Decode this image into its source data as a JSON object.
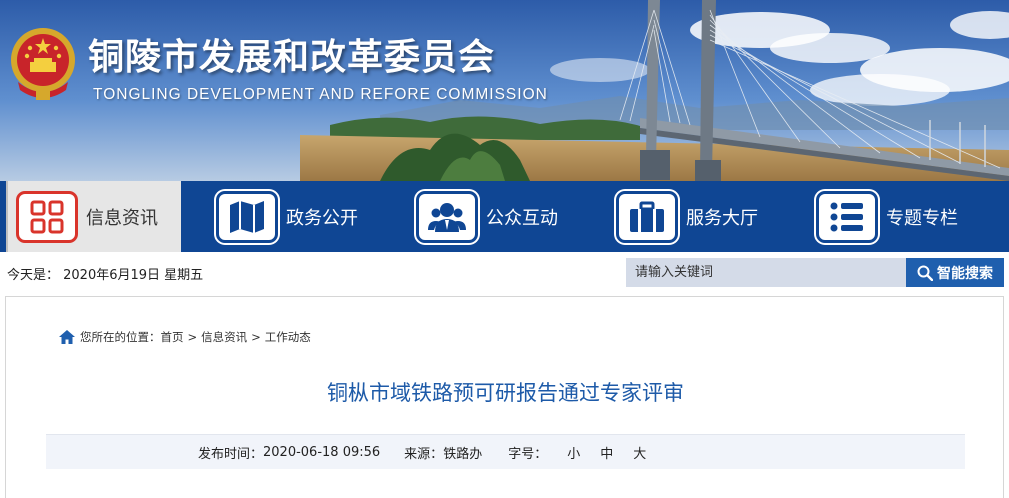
{
  "header": {
    "title": "铜陵市发展和改革委员会",
    "subtitle": "TONGLING DEVELOPMENT AND REFORE COMMISSION"
  },
  "nav": {
    "items": [
      {
        "label": "信息资讯",
        "icon": "grid-icon",
        "active": true
      },
      {
        "label": "政务公开",
        "icon": "map-icon",
        "active": false
      },
      {
        "label": "公众互动",
        "icon": "people-icon",
        "active": false
      },
      {
        "label": "服务大厅",
        "icon": "briefcase-icon",
        "active": false
      },
      {
        "label": "专题专栏",
        "icon": "list-icon",
        "active": false
      }
    ]
  },
  "infobar": {
    "date_text": "今天是： 2020年6月19日 星期五",
    "search_placeholder": "请输入关键词",
    "search_button": "智能搜索"
  },
  "breadcrumb": {
    "prefix": "您所在的位置：",
    "items": [
      "首页",
      "信息资讯",
      "工作动态"
    ],
    "separator": ">"
  },
  "article": {
    "title": "铜枞市域铁路预可研报告通过专家评审",
    "publish_label": "发布时间：",
    "publish_time": "2020-06-18 09:56",
    "source_label": "来源：",
    "source": "铁路办",
    "font_size_label": "字号：",
    "font_sizes": [
      "小",
      "中",
      "大"
    ]
  },
  "colors": {
    "nav_bg": "#0f4694",
    "accent_red": "#d9342b",
    "title_blue": "#1d5aa8",
    "search_button": "#1f5fae"
  }
}
